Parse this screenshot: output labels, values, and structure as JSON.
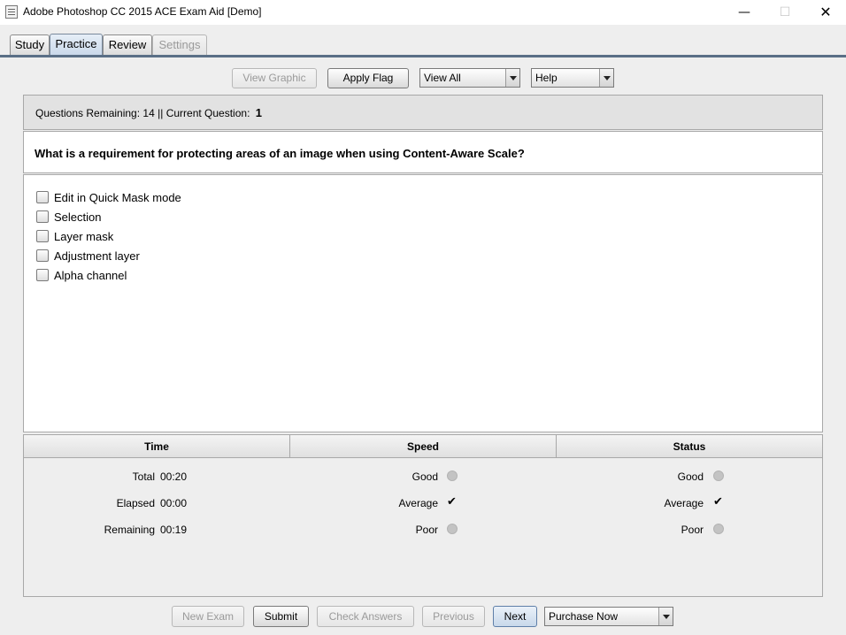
{
  "window": {
    "title": "Adobe Photoshop CC 2015 ACE Exam Aid [Demo]",
    "minimize_glyph": "—",
    "maximize_glyph": "☐",
    "close_glyph": "✕"
  },
  "tabs": [
    {
      "label": "Study",
      "state": "normal"
    },
    {
      "label": "Practice",
      "state": "active"
    },
    {
      "label": "Review",
      "state": "normal"
    },
    {
      "label": "Settings",
      "state": "disabled"
    }
  ],
  "toolbar": {
    "view_graphic": "View Graphic",
    "apply_flag": "Apply Flag",
    "view_filter": "View All",
    "help": "Help"
  },
  "status": {
    "questions_remaining_label": "Questions Remaining:",
    "questions_remaining": "14",
    "separator": "||",
    "current_question_label": "Current Question:",
    "current_question": "1"
  },
  "question": {
    "text": "What is a requirement for protecting areas of an image when using Content-Aware Scale?"
  },
  "answers": [
    "Edit in Quick Mask mode",
    "Selection",
    "Layer mask",
    "Adjustment layer",
    "Alpha channel"
  ],
  "stats": {
    "headers": [
      "Time",
      "Speed",
      "Status"
    ],
    "time": [
      {
        "label": "Total",
        "value": "00:20"
      },
      {
        "label": "Elapsed",
        "value": "00:00"
      },
      {
        "label": "Remaining",
        "value": "00:19"
      }
    ],
    "speed": [
      {
        "label": "Good",
        "selected": false
      },
      {
        "label": "Average",
        "selected": true
      },
      {
        "label": "Poor",
        "selected": false
      }
    ],
    "status": [
      {
        "label": "Good",
        "selected": false
      },
      {
        "label": "Average",
        "selected": true
      },
      {
        "label": "Poor",
        "selected": false
      }
    ],
    "check_glyph": "✔"
  },
  "bottom": {
    "new_exam": "New Exam",
    "submit": "Submit",
    "check_answers": "Check Answers",
    "previous": "Previous",
    "next": "Next",
    "purchase": "Purchase Now"
  }
}
